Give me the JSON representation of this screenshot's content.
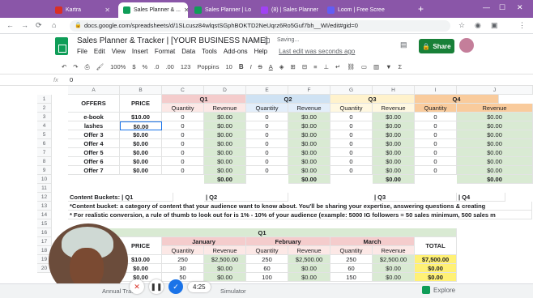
{
  "browser": {
    "tabs": [
      {
        "label": "Kartra",
        "color": "#d93025"
      },
      {
        "label": "Sales Planner & ...",
        "color": "#0f9d58"
      },
      {
        "label": "Sales Planner | Lo",
        "color": "#0f9d58"
      },
      {
        "label": "(8) | Sales Planner",
        "color": "#a142f4"
      },
      {
        "label": "Loom | Free Scree",
        "color": "#625df5"
      }
    ],
    "url": "docs.google.com/spreadsheets/d/1SLcusz84wlqstSGphBOKTD2NeUqrz6Ro5Guf7bh__WI/edit#gid=0"
  },
  "app": {
    "title": "Sales Planner & Tracker | [YOUR BUSINESS NAME]",
    "saving": "Saving...",
    "menu": [
      "File",
      "Edit",
      "View",
      "Insert",
      "Format",
      "Data",
      "Tools",
      "Add-ons",
      "Help"
    ],
    "last_edit": "Last edit was seconds ago",
    "share_label": "Share"
  },
  "toolbar": {
    "zoom": "100%",
    "currency": "$",
    "percent": "%",
    "decimals": ".0",
    "dec2": ".00",
    "format": "123",
    "font": "Poppins",
    "size": "10"
  },
  "formula": {
    "fx": "fx",
    "value": "0"
  },
  "columns": [
    "A",
    "B",
    "C",
    "D",
    "E",
    "F",
    "G",
    "H",
    "I",
    "J"
  ],
  "rows": [
    "1",
    "2",
    "3",
    "4",
    "5",
    "6",
    "7",
    "8",
    "9",
    "10",
    "11",
    "12",
    "13",
    "14",
    "15",
    "16",
    "17",
    "18",
    "19",
    "20"
  ],
  "table1": {
    "offers_header": "OFFERS",
    "price_header": "PRICE",
    "quarters": [
      "Q1",
      "Q2",
      "Q3",
      "Q4"
    ],
    "sub_qty": "Quantity",
    "sub_rev": "Revenue",
    "rows": [
      {
        "offer": "e-book",
        "price": "$10.00"
      },
      {
        "offer": "lashes",
        "price": "$0.00"
      },
      {
        "offer": "Offer 3",
        "price": "$0.00"
      },
      {
        "offer": "Offer 4",
        "price": "$0.00"
      },
      {
        "offer": "Offer 5",
        "price": "$0.00"
      },
      {
        "offer": "Offer 6",
        "price": "$0.00"
      },
      {
        "offer": "Offer 7",
        "price": "$0.00"
      }
    ],
    "qty": "0",
    "rev": "$0.00",
    "total": "$0.00"
  },
  "buckets": {
    "row13": [
      "Content Buckets: | Q1",
      "| Q2",
      "| Q3",
      "| Q4",
      "|"
    ],
    "row14": "*Content bucket: a category of content that your audience want to know about. You'll be sharing your expertise, answering questions & creating",
    "row15": "* For realistic conversion, a rule of thumb to look out for is 1% - 10% of your audience (example: 5000 IG followers = 50 sales minimum, 500 sales m"
  },
  "table2": {
    "q1": "Q1",
    "price_header": "PRICE",
    "months": [
      "January",
      "February",
      "March"
    ],
    "total_header": "TOTAL",
    "sub_qty": "Quantity",
    "sub_rev": "Revenue",
    "rows": [
      {
        "price": "$10.00",
        "m": [
          [
            "250",
            "$2,500.00"
          ],
          [
            "250",
            "$2,500.00"
          ],
          [
            "250",
            "$2,500.00"
          ]
        ],
        "total": "$7,500.00"
      },
      {
        "price": "$0.00",
        "m": [
          [
            "30",
            "$0.00"
          ],
          [
            "60",
            "$0.00"
          ],
          [
            "60",
            "$0.00"
          ]
        ],
        "total": "$0.00"
      },
      {
        "price": "$0.00",
        "m": [
          [
            "50",
            "$0.00"
          ],
          [
            "100",
            "$0.00"
          ],
          [
            "150",
            "$0.00"
          ]
        ],
        "total": "$0.00"
      }
    ]
  },
  "sheet_tabs": [
    "Annual Trac...",
    "Simulator"
  ],
  "explore": "Explore",
  "recorder": {
    "time": "4:25"
  }
}
